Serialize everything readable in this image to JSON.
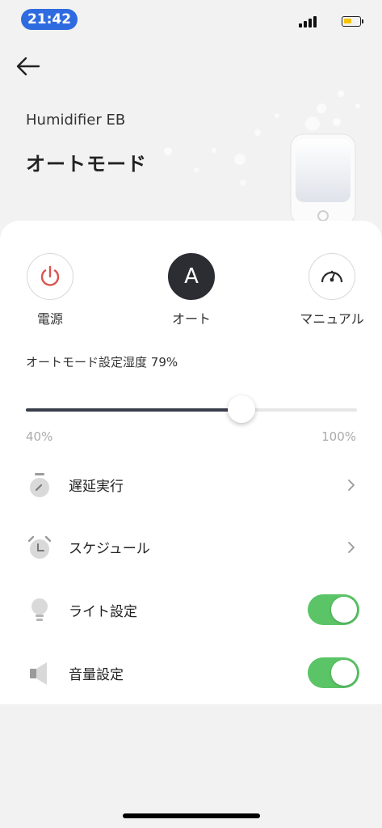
{
  "status_bar": {
    "time": "21:42",
    "battery_color": "#f5c400"
  },
  "header": {
    "device_name": "Humidifier EB",
    "mode_title": "オートモード"
  },
  "modes": [
    {
      "label": "電源",
      "icon": "power-icon",
      "color": "#d9534f"
    },
    {
      "label": "オート",
      "icon_text": "A",
      "active": true
    },
    {
      "label": "マニュアル",
      "icon": "gauge-icon"
    }
  ],
  "humidity": {
    "label": "オートモード設定湿度 79%",
    "min_label": "40%",
    "max_label": "100%",
    "value": 79,
    "min": 40,
    "max": 100
  },
  "settings": [
    {
      "label": "遅延実行",
      "icon": "timer-icon",
      "control": "chevron"
    },
    {
      "label": "スケジュール",
      "icon": "alarm-clock-icon",
      "control": "chevron"
    },
    {
      "label": "ライト設定",
      "icon": "lightbulb-icon",
      "control": "toggle",
      "on": true
    },
    {
      "label": "音量設定",
      "icon": "speaker-icon",
      "control": "toggle",
      "on": true
    }
  ],
  "colors": {
    "accent_dark": "#2c2d33",
    "toggle_on": "#5ac466",
    "power_red": "#d9534f"
  }
}
